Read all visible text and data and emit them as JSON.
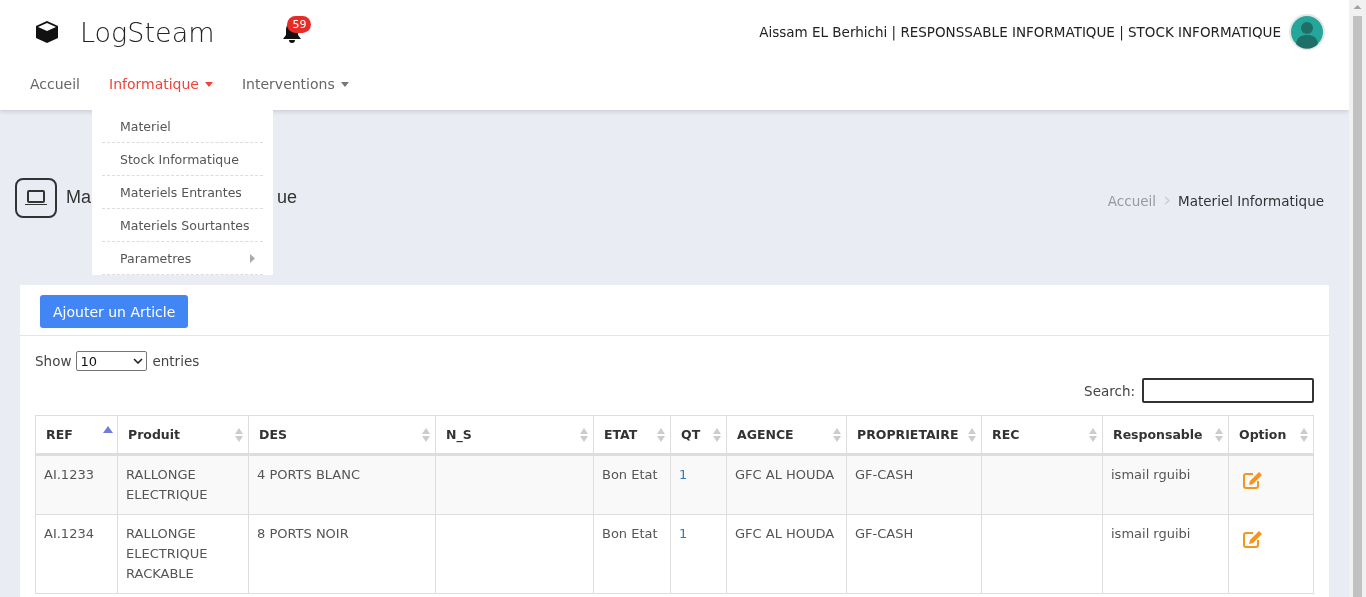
{
  "header": {
    "brand": "LogSteam",
    "notifications": "59",
    "user_info": "Aissam EL Berhichi | RESPONSSABLE INFORMATIQUE | STOCK INFORMATIQUE"
  },
  "nav": [
    {
      "label": "Accueil",
      "selected": false,
      "has_menu": false
    },
    {
      "label": "Informatique",
      "selected": true,
      "has_menu": true
    },
    {
      "label": "Interventions",
      "selected": false,
      "has_menu": true
    }
  ],
  "dropdown": [
    {
      "label": "Materiel",
      "submenu": false
    },
    {
      "label": "Stock Informatique",
      "submenu": false
    },
    {
      "label": "Materiels Entrantes",
      "submenu": false
    },
    {
      "label": "Materiels Sourtantes",
      "submenu": false
    },
    {
      "label": "Parametres",
      "submenu": true
    }
  ],
  "page_title_visible": [
    "Ma",
    "ue"
  ],
  "breadcrumb": [
    {
      "label": "Accueil",
      "current": false
    },
    {
      "label": "Materiel Informatique",
      "current": true
    }
  ],
  "add_button": "Ajouter un Article",
  "length_control": {
    "before": "Show",
    "value": "10",
    "after": "entries"
  },
  "search": {
    "label": "Search:"
  },
  "table": {
    "columns": [
      {
        "label": "REF",
        "sorted": true
      },
      {
        "label": "Produit",
        "sorted": false
      },
      {
        "label": "DES",
        "sorted": false
      },
      {
        "label": "N_S",
        "sorted": false
      },
      {
        "label": "ETAT",
        "sorted": false
      },
      {
        "label": "QT",
        "sorted": false
      },
      {
        "label": "AGENCE",
        "sorted": false
      },
      {
        "label": "PROPRIETAIRE",
        "sorted": false
      },
      {
        "label": "REC",
        "sorted": false
      },
      {
        "label": "Responsable",
        "sorted": false
      },
      {
        "label": "Option",
        "sorted": false
      }
    ],
    "rows": [
      {
        "cells": [
          "AI.1233",
          "RALLONGE ELECTRIQUE",
          "4 PORTS BLANC",
          "",
          "Bon Etat",
          "1",
          "GFC AL HOUDA",
          "GF-CASH",
          "",
          "ismail rguibi"
        ],
        "editable": true
      },
      {
        "cells": [
          "AI.1234",
          "RALLONGE ELECTRIQUE RACKABLE",
          "8 PORTS NOIR",
          "",
          "Bon Etat",
          "1",
          "GFC AL HOUDA",
          "GF-CASH",
          "",
          "ismail rguibi"
        ],
        "editable": true
      }
    ]
  }
}
